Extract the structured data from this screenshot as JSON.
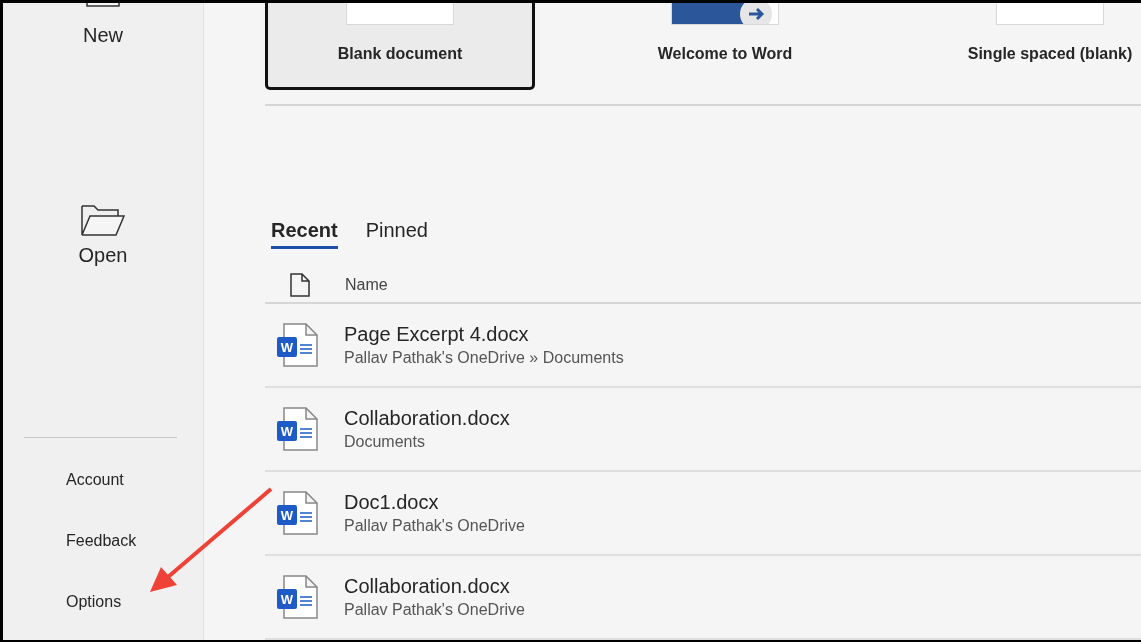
{
  "sidebar": {
    "top_items": [
      {
        "label": "New",
        "kind": "new"
      },
      {
        "label": "Open",
        "kind": "open"
      }
    ],
    "bottom_items": [
      {
        "label": "Account"
      },
      {
        "label": "Feedback"
      },
      {
        "label": "Options"
      }
    ]
  },
  "templates": [
    {
      "label": "Blank document",
      "kind": "blank",
      "selected": true
    },
    {
      "label": "Welcome to Word",
      "kind": "welcome",
      "selected": false
    },
    {
      "label": "Single spaced (blank)",
      "kind": "blank",
      "selected": false
    }
  ],
  "tabs": [
    {
      "label": "Recent",
      "selected": true
    },
    {
      "label": "Pinned",
      "selected": false
    }
  ],
  "file_list": {
    "header": "Name",
    "files": [
      {
        "name": "Page Excerpt 4.docx",
        "location": "Pallav Pathak's OneDrive » Documents",
        "icon_letter": "W"
      },
      {
        "name": "Collaboration.docx",
        "location": "Documents",
        "icon_letter": "W"
      },
      {
        "name": "Doc1.docx",
        "location": "Pallav Pathak's OneDrive",
        "icon_letter": "W"
      },
      {
        "name": "Collaboration.docx",
        "location": "Pallav Pathak's OneDrive",
        "icon_letter": "W"
      }
    ]
  }
}
